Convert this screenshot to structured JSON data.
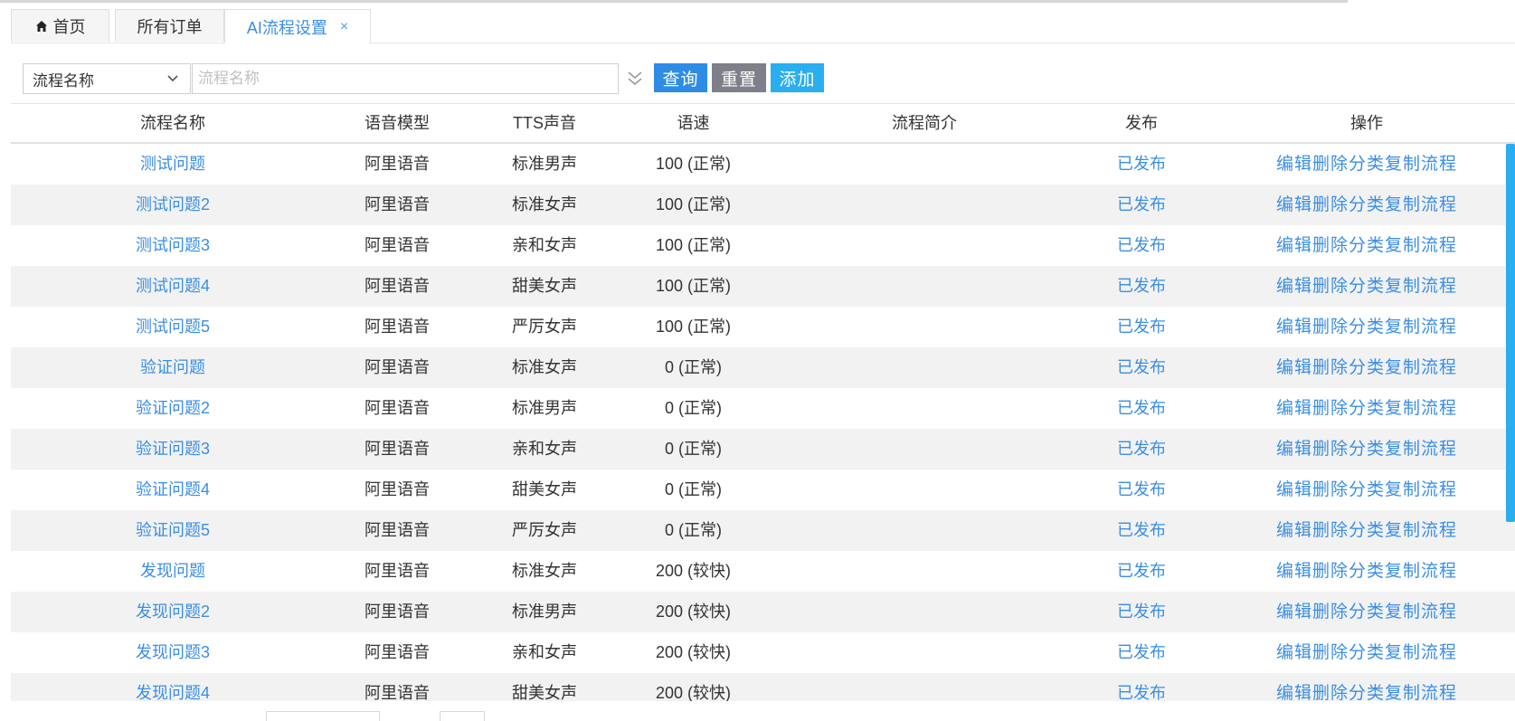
{
  "tabs": [
    {
      "label": "首页",
      "icon": "home-icon"
    },
    {
      "label": "所有订单"
    },
    {
      "label": "AI流程设置",
      "close": "×",
      "active": true
    }
  ],
  "search": {
    "field_select": "流程名称",
    "placeholder": "流程名称",
    "query_label": "查询",
    "reset_label": "重置",
    "add_label": "添加"
  },
  "table": {
    "headers": {
      "name": "流程名称",
      "model": "语音模型",
      "tts": "TTS声音",
      "speed": "语速",
      "desc": "流程简介",
      "publish": "发布",
      "ops": "操作"
    },
    "ops_labels": [
      "编辑",
      "删除",
      "分类",
      "复制流程"
    ],
    "rows": [
      {
        "name": "测试问题",
        "model": "阿里语音",
        "tts": "标准男声",
        "speed": "100 (正常)",
        "desc": "",
        "publish": "已发布"
      },
      {
        "name": "测试问题2",
        "model": "阿里语音",
        "tts": "标准女声",
        "speed": "100 (正常)",
        "desc": "",
        "publish": "已发布"
      },
      {
        "name": "测试问题3",
        "model": "阿里语音",
        "tts": "亲和女声",
        "speed": "100 (正常)",
        "desc": "",
        "publish": "已发布"
      },
      {
        "name": "测试问题4",
        "model": "阿里语音",
        "tts": "甜美女声",
        "speed": "100 (正常)",
        "desc": "",
        "publish": "已发布"
      },
      {
        "name": "测试问题5",
        "model": "阿里语音",
        "tts": "严厉女声",
        "speed": "100 (正常)",
        "desc": "",
        "publish": "已发布"
      },
      {
        "name": "验证问题",
        "model": "阿里语音",
        "tts": "标准女声",
        "speed": "0 (正常)",
        "desc": "",
        "publish": "已发布"
      },
      {
        "name": "验证问题2",
        "model": "阿里语音",
        "tts": "标准男声",
        "speed": "0 (正常)",
        "desc": "",
        "publish": "已发布"
      },
      {
        "name": "验证问题3",
        "model": "阿里语音",
        "tts": "亲和女声",
        "speed": "0 (正常)",
        "desc": "",
        "publish": "已发布"
      },
      {
        "name": "验证问题4",
        "model": "阿里语音",
        "tts": "甜美女声",
        "speed": "0 (正常)",
        "desc": "",
        "publish": "已发布"
      },
      {
        "name": "验证问题5",
        "model": "阿里语音",
        "tts": "严厉女声",
        "speed": "0 (正常)",
        "desc": "",
        "publish": "已发布"
      },
      {
        "name": "发现问题",
        "model": "阿里语音",
        "tts": "标准女声",
        "speed": "200 (较快)",
        "desc": "",
        "publish": "已发布"
      },
      {
        "name": "发现问题2",
        "model": "阿里语音",
        "tts": "标准男声",
        "speed": "200 (较快)",
        "desc": "",
        "publish": "已发布"
      },
      {
        "name": "发现问题3",
        "model": "阿里语音",
        "tts": "亲和女声",
        "speed": "200 (较快)",
        "desc": "",
        "publish": "已发布"
      },
      {
        "name": "发现问题4",
        "model": "阿里语音",
        "tts": "甜美女声",
        "speed": "200 (较快)",
        "desc": "",
        "publish": "已发布"
      }
    ]
  },
  "colors": {
    "accent": "#3a8ee6",
    "query_btn": "#2f8ce6",
    "reset_btn": "#7d8089",
    "add_btn": "#29aef0",
    "scrollbar": "#29aef0",
    "stripe": "#f2f2f2"
  }
}
